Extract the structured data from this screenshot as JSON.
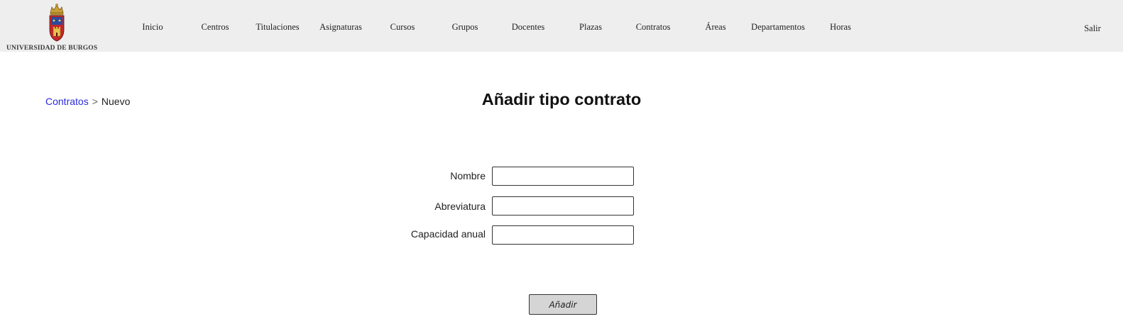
{
  "header": {
    "logo_text": "UNIVERSIDAD DE BURGOS",
    "logo_icon": "university-crest",
    "nav": [
      {
        "label": "Inicio"
      },
      {
        "label": "Centros"
      },
      {
        "label": "Titulaciones"
      },
      {
        "label": "Asignaturas"
      },
      {
        "label": "Cursos"
      },
      {
        "label": "Grupos"
      },
      {
        "label": "Docentes"
      },
      {
        "label": "Plazas"
      },
      {
        "label": "Contratos"
      },
      {
        "label": "Áreas"
      },
      {
        "label": "Departamentos"
      },
      {
        "label": "Horas"
      }
    ],
    "logout": "Salir"
  },
  "breadcrumb": {
    "parent": "Contratos",
    "separator": ">",
    "current": "Nuevo"
  },
  "page_title": "Añadir tipo contrato",
  "form": {
    "fields": [
      {
        "label": "Nombre",
        "value": ""
      },
      {
        "label": "Abreviatura",
        "value": ""
      },
      {
        "label": "Capacidad anual",
        "value": ""
      }
    ],
    "submit_label": "Añadir"
  },
  "colors": {
    "header_bg": "#eeeeee",
    "link": "#2a2add",
    "button_bg": "#d5d5d5"
  }
}
